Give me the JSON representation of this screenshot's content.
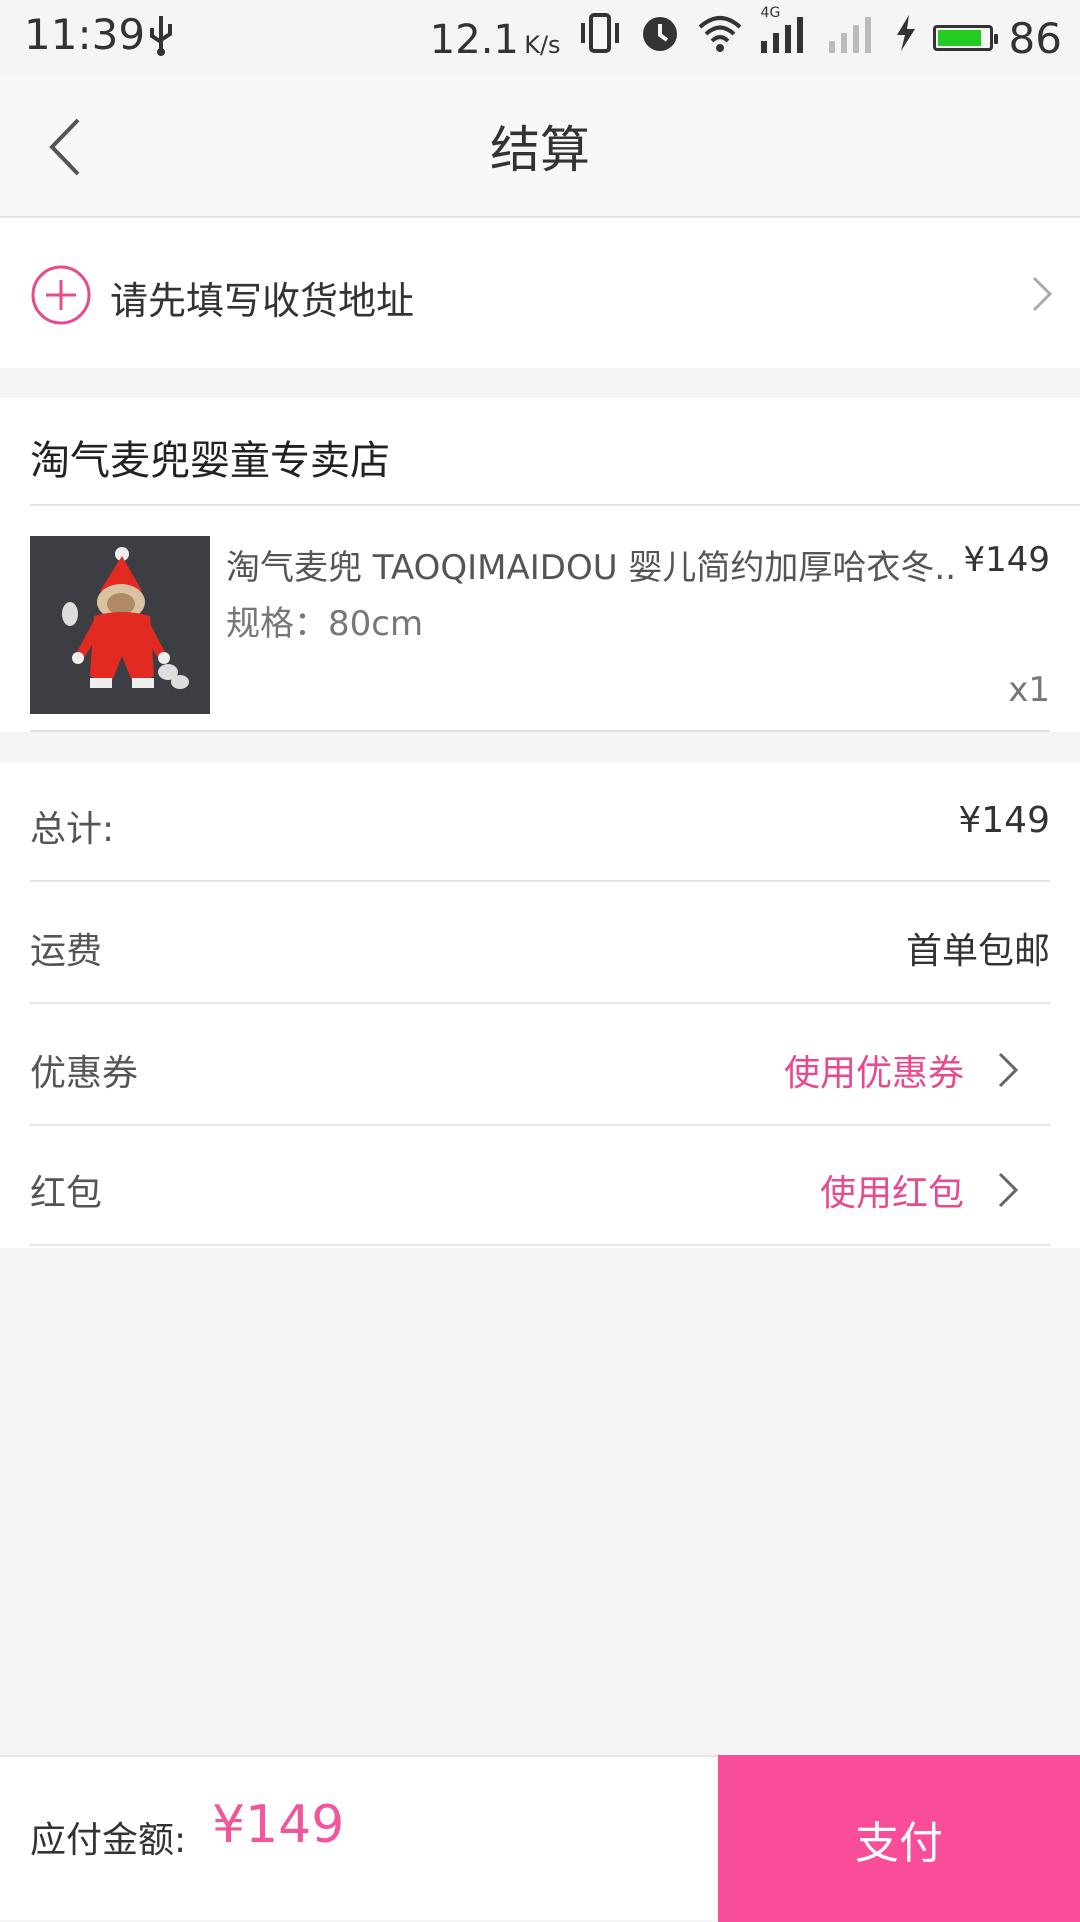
{
  "status_bar": {
    "time": "11:39",
    "speed": "12.1",
    "speed_unit": "K/s",
    "network": "4G",
    "battery": "86",
    "battery_level": 0.86
  },
  "header": {
    "title": "结算"
  },
  "address": {
    "prompt": "请先填写收货地址"
  },
  "shop": {
    "name": "淘气麦兜婴童专卖店",
    "product": {
      "title": "淘气麦兜 TAOQIMAIDOU 婴儿简约加厚哈衣冬..",
      "price": "¥149",
      "spec": "规格：80cm",
      "qty": "x1"
    }
  },
  "summary": {
    "rows": [
      {
        "label": "总计:",
        "value": "¥149"
      },
      {
        "label": "运费",
        "value": "首单包邮"
      },
      {
        "label": "优惠券",
        "value": "使用优惠券"
      },
      {
        "label": "红包",
        "value": "使用红包"
      }
    ]
  },
  "bottom": {
    "due_label": "应付金额:",
    "due_amount": "¥149",
    "pay_label": "支付"
  },
  "colors": {
    "accent": "#f94d9a",
    "accent_text": "#e8498f",
    "battery": "#22cc22"
  }
}
